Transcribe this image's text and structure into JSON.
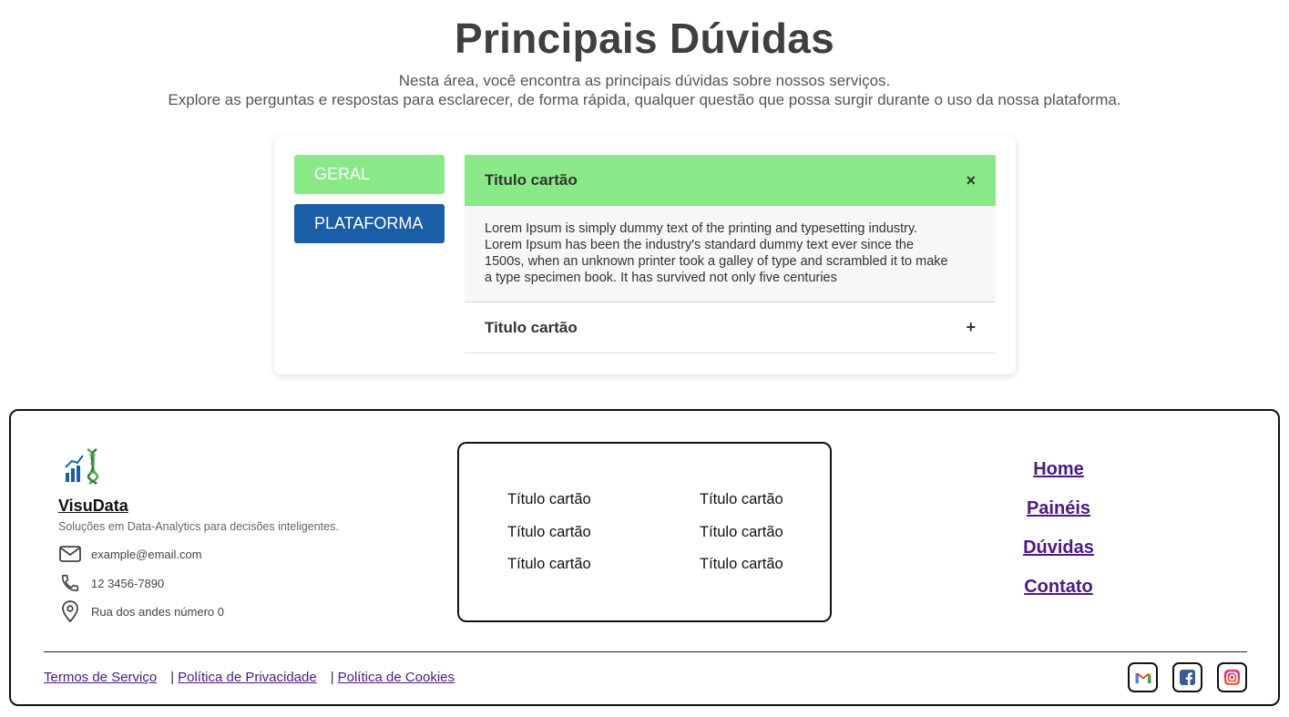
{
  "hero": {
    "title": "Principais Dúvidas",
    "line1": "Nesta área, você encontra as principais dúvidas sobre nossos serviços.",
    "line2": "Explore as perguntas e respostas para esclarecer, de forma rápida, qualquer questão que possa surgir durante o uso da nossa plataforma."
  },
  "faq": {
    "categories": [
      {
        "label": "GERAL",
        "color": "#88e986"
      },
      {
        "label": "PLATAFORMA",
        "color": "#1a5ea8"
      }
    ],
    "items": [
      {
        "title": "Titulo cartão",
        "icon": "×",
        "open": true,
        "body": "Lorem Ipsum is simply dummy text of the printing and typesetting industry. Lorem Ipsum has been the industry's standard dummy text ever since the 1500s, when an unknown printer took a galley of type and scrambled it to make a type specimen book. It has survived not only five centuries"
      },
      {
        "title": "Titulo cartão",
        "icon": "+",
        "open": false
      }
    ]
  },
  "footer": {
    "brand": "VisuData",
    "tagline": "Soluções em Data-Analytics para decisões inteligentes.",
    "email": "example@email.com",
    "phone": "12 3456-7890",
    "address": "Rua dos andes número 0",
    "links": [
      "Título cartão",
      "Título cartão",
      "Título cartão",
      "Título cartão",
      "Título cartão",
      "Título cartão"
    ],
    "nav": [
      "Home",
      "Painéis",
      "Dúvidas",
      "Contato"
    ],
    "legal": {
      "terms": "Termos de Serviço",
      "sep": "|",
      "privacy": "Política de Privacidade",
      "cookies": "Política de Cookies"
    },
    "social_icons": [
      "gmail-icon",
      "facebook-icon",
      "instagram-icon"
    ],
    "link_color": "#4b1a86"
  }
}
